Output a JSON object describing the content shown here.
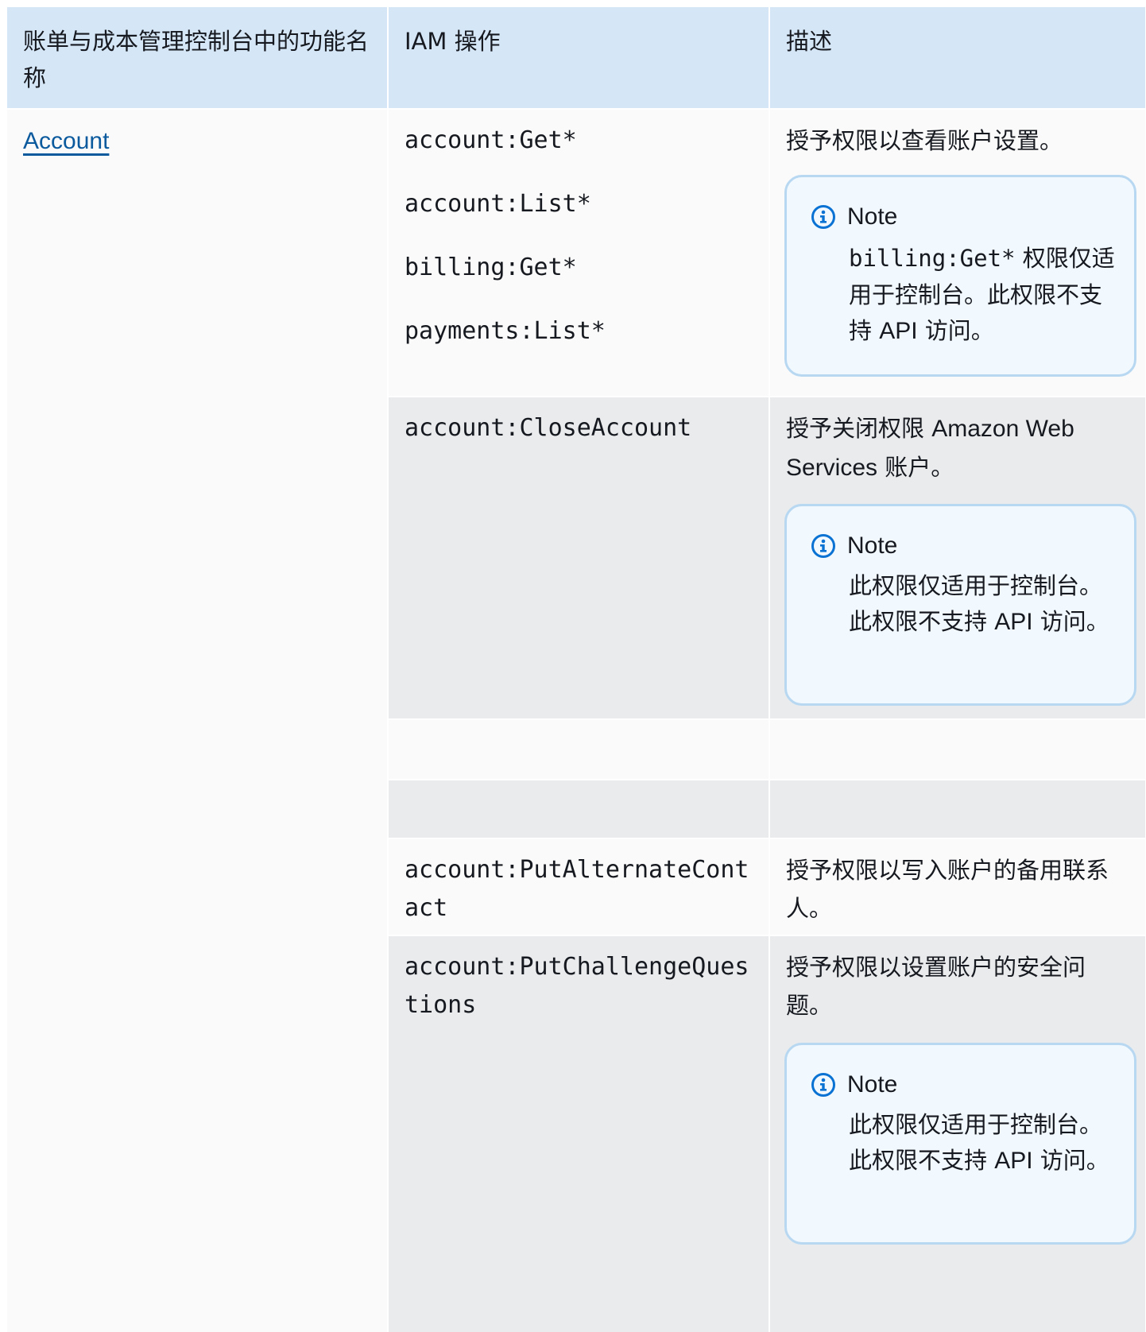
{
  "header": {
    "col1": "账单与成本管理控制台中的功能名称",
    "col2": "IAM 操作",
    "col3": "描述"
  },
  "feature_link": "Account",
  "rows": [
    {
      "actions": [
        "account:Get*",
        "account:List*",
        "billing:Get*",
        "payments:List*"
      ],
      "description": "授予权限以查看账户设置。",
      "note": {
        "title": "Note",
        "code": "billing:Get*",
        "body_a": " 权限",
        "body_b": "仅适用于控制台。此权限不支持 ",
        "api": "API",
        "body_c": " 访问。"
      }
    },
    {
      "actions": [
        "account:CloseAccount"
      ],
      "description_a": "授予关闭权限 ",
      "description_b": "Amazon Web Services",
      "description_c": " 账户。",
      "note": {
        "title": "Note",
        "body_a": "此权限仅适用于控制台。此权限不支持 ",
        "api": "API",
        "body_c": " 访问。"
      }
    },
    {
      "actions": [
        "account:PutAlternateContact"
      ],
      "description": "授予权限以写入账户的备用联系人。"
    },
    {
      "actions": [
        "account:PutChallengeQuestions"
      ],
      "description": "授予权限以设置账户的安全问题。",
      "note": {
        "title": "Note",
        "body_a": "此权限仅适用于控制台。此权限不支持 ",
        "api": "API",
        "body_c": " 访问。"
      }
    }
  ],
  "icons": {
    "note": "info-icon"
  },
  "colors": {
    "header": "#d5e6f7",
    "note_border": "#b8d8f2",
    "link": "#0b5a9e",
    "icon": "#0972d3"
  }
}
